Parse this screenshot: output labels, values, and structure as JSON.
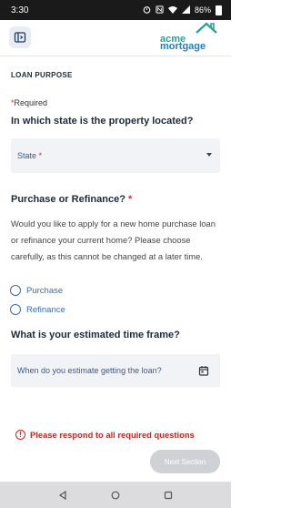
{
  "status_bar": {
    "time": "3:30",
    "battery": "86%",
    "icons": [
      "alarm-icon",
      "nfc-icon",
      "wifi-icon",
      "signal-icon",
      "battery-icon"
    ]
  },
  "header": {
    "logo_line1": "acme",
    "logo_line2": "mortgage",
    "menu_icon": "sidebar-toggle-icon"
  },
  "form": {
    "section_title": "LOAN PURPOSE",
    "required_note": "Required",
    "q_state": "In which state is the property located?",
    "state_select_label": "State",
    "q_purpose": "Purchase or Refinance?",
    "purpose_desc": "Would you like to apply for a new home purchase loan or refinance your current home? Please choose carefully, as this cannot be changed at a later time.",
    "option_purchase": "Purchase",
    "option_refinance": "Refinance",
    "q_timeframe": "What is your estimated time frame?",
    "timeframe_placeholder": "When do you estimate getting the loan?",
    "error_message": "Please respond to all required questions",
    "next_button": "Next Section"
  },
  "colors": {
    "required_red": "#d32f2f",
    "link_blue": "#3a6cb0",
    "logo_teal": "#2aa198",
    "logo_blue": "#1e7fc3",
    "disabled_button": "#cfd1d4"
  }
}
